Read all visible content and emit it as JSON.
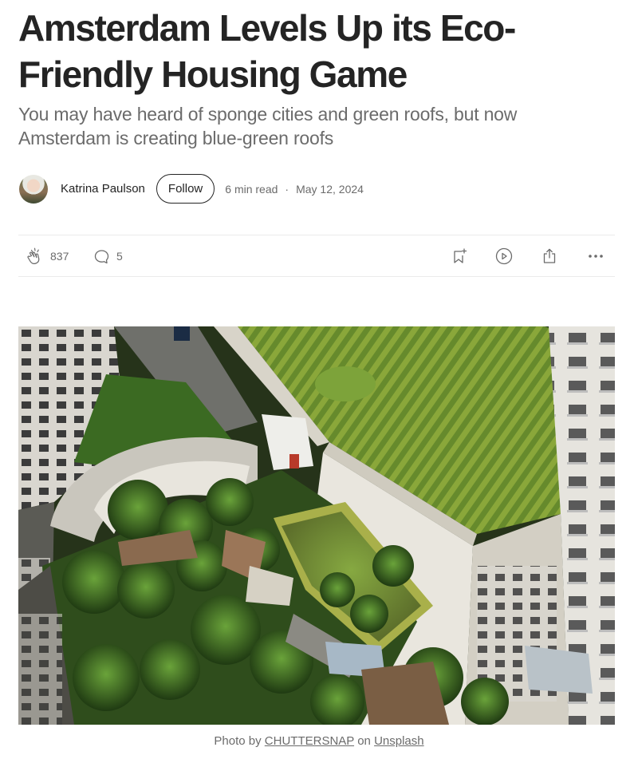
{
  "article": {
    "title": "Amsterdam Levels Up its Eco-Friendly Housing Game",
    "subtitle": "You may have heard of sponge cities and green roofs, but now Amsterdam is creating blue-green roofs"
  },
  "byline": {
    "author": "Katrina Paulson",
    "follow_label": "Follow",
    "read_time": "6 min read",
    "separator": "·",
    "date": "May 12, 2024"
  },
  "actions": {
    "claps": "837",
    "responses": "5",
    "icons": [
      "clap-icon",
      "comment-icon",
      "bookmark-add-icon",
      "play-icon",
      "share-icon",
      "more-icon"
    ]
  },
  "image": {
    "description_icon": "rooftop-garden-photo"
  },
  "caption": {
    "prefix": "Photo by",
    "photographer": "CHUTTERSNAP",
    "middle": "on",
    "source": "Unsplash"
  },
  "colors": {
    "text": "#242424",
    "muted": "#6b6b6b",
    "divider": "#ebebeb"
  }
}
